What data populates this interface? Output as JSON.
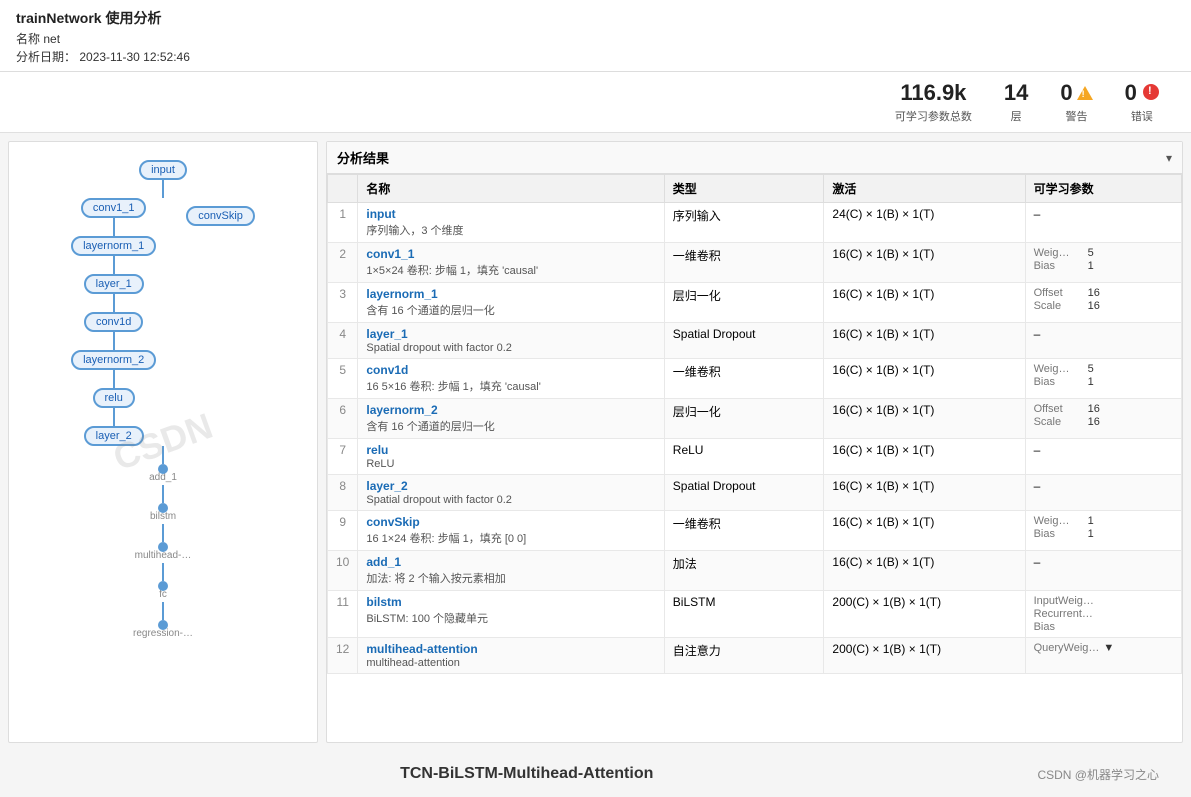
{
  "app": {
    "title": "trainNetwork 使用分析",
    "name_label": "名称",
    "name_value": "net",
    "date_label": "分析日期：",
    "date_value": "2023-11-30 12:52:46"
  },
  "stats": {
    "params_value": "116.9k",
    "params_label": "可学习参数总数",
    "layers_value": "14",
    "layers_label": "层",
    "warnings_value": "0",
    "warnings_label": "警告",
    "errors_value": "0",
    "errors_label": "错误"
  },
  "panel": {
    "title": "分析结果",
    "collapse_label": "▾"
  },
  "table": {
    "headers": [
      "",
      "名称",
      "类型",
      "激活",
      "可学习参数"
    ],
    "rows": [
      {
        "num": "1",
        "name": "input",
        "desc": "序列输入，3 个维度",
        "type": "序列输入",
        "activation": "24(C) × 1(B) × 1(T)",
        "params": "–"
      },
      {
        "num": "2",
        "name": "conv1_1",
        "desc": "1×5×24 卷积: 步幅 1，填充 'causal'",
        "type": "一维卷积",
        "activation": "16(C) × 1(B) × 1(T)",
        "params_group": [
          {
            "key": "Weig…",
            "val": "5"
          },
          {
            "key": "Bias",
            "val": "1"
          }
        ]
      },
      {
        "num": "3",
        "name": "layernorm_1",
        "desc": "含有 16 个通道的层归一化",
        "type": "层归一化",
        "activation": "16(C) × 1(B) × 1(T)",
        "params_group": [
          {
            "key": "Offset",
            "val": "16"
          },
          {
            "key": "Scale",
            "val": "16"
          }
        ]
      },
      {
        "num": "4",
        "name": "layer_1",
        "desc": "Spatial dropout with factor 0.2",
        "type": "Spatial Dropout",
        "activation": "16(C) × 1(B) × 1(T)",
        "params": "–"
      },
      {
        "num": "5",
        "name": "conv1d",
        "desc": "16 5×16 卷积: 步幅 1，填充 'causal'",
        "type": "一维卷积",
        "activation": "16(C) × 1(B) × 1(T)",
        "params_group": [
          {
            "key": "Weig…",
            "val": "5"
          },
          {
            "key": "Bias",
            "val": "1"
          }
        ]
      },
      {
        "num": "6",
        "name": "layernorm_2",
        "desc": "含有 16 个通道的层归一化",
        "type": "层归一化",
        "activation": "16(C) × 1(B) × 1(T)",
        "params_group": [
          {
            "key": "Offset",
            "val": "16"
          },
          {
            "key": "Scale",
            "val": "16"
          }
        ]
      },
      {
        "num": "7",
        "name": "relu",
        "desc": "ReLU",
        "type": "ReLU",
        "activation": "16(C) × 1(B) × 1(T)",
        "params": "–"
      },
      {
        "num": "8",
        "name": "layer_2",
        "desc": "Spatial dropout with factor 0.2",
        "type": "Spatial Dropout",
        "activation": "16(C) × 1(B) × 1(T)",
        "params": "–"
      },
      {
        "num": "9",
        "name": "convSkip",
        "desc": "16 1×24 卷积: 步幅 1，填充 [0 0]",
        "type": "一维卷积",
        "activation": "16(C) × 1(B) × 1(T)",
        "params_group": [
          {
            "key": "Weig…",
            "val": "1"
          },
          {
            "key": "Bias",
            "val": "1"
          }
        ]
      },
      {
        "num": "10",
        "name": "add_1",
        "desc": "加法: 将 2 个输入按元素相加",
        "type": "加法",
        "activation": "16(C) × 1(B) × 1(T)",
        "params": "–"
      },
      {
        "num": "11",
        "name": "bilstm",
        "desc": "BiLSTM: 100 个隐藏单元",
        "type": "BiLSTM",
        "activation": "200(C) × 1(B) × 1(T)",
        "params_group": [
          {
            "key": "InputWeig…",
            "val": ""
          },
          {
            "key": "Recurrent…",
            "val": ""
          },
          {
            "key": "Bias",
            "val": ""
          }
        ]
      },
      {
        "num": "12",
        "name": "multihead-attention",
        "desc": "multihead-attention",
        "type": "自注意力",
        "activation": "200(C) × 1(B) × 1(T)",
        "params_group": [
          {
            "key": "QueryWeig…",
            "val": "▼"
          }
        ]
      }
    ]
  },
  "network": {
    "nodes": [
      {
        "id": "input",
        "label": "input",
        "type": "input"
      },
      {
        "id": "conv1_1",
        "label": "conv1_1",
        "type": "node"
      },
      {
        "id": "convSkip",
        "label": "convSkip",
        "type": "node"
      },
      {
        "id": "layernorm_1",
        "label": "layernorm_1",
        "type": "node"
      },
      {
        "id": "layer_1",
        "label": "layer_1",
        "type": "node"
      },
      {
        "id": "conv1d",
        "label": "conv1d",
        "type": "node"
      },
      {
        "id": "layernorm_2",
        "label": "layernorm_2",
        "type": "node"
      },
      {
        "id": "relu",
        "label": "relu",
        "type": "node"
      },
      {
        "id": "layer_2",
        "label": "layer_2",
        "type": "node"
      },
      {
        "id": "add_1",
        "label": "add_1",
        "type": "node"
      },
      {
        "id": "bilstm",
        "label": "bilstm",
        "type": "node"
      },
      {
        "id": "multihead",
        "label": "multihead-…",
        "type": "node"
      },
      {
        "id": "fc",
        "label": "fc",
        "type": "node"
      },
      {
        "id": "regression",
        "label": "regression-…",
        "type": "node"
      }
    ]
  },
  "footer": {
    "title": "TCN-BiLSTM-Multihead-Attention",
    "subtitle": "CSDN @机器学习之心"
  }
}
